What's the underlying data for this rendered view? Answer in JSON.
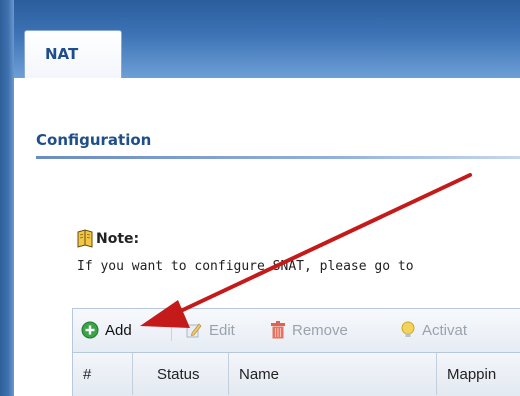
{
  "tabs": [
    {
      "label": "NAT"
    }
  ],
  "section": {
    "title": "Configuration"
  },
  "note": {
    "title": "Note:",
    "text": "If you want to configure SNAT, please go to"
  },
  "toolbar": {
    "add_label": "Add",
    "edit_label": "Edit",
    "remove_label": "Remove",
    "activate_label": "Activat"
  },
  "table": {
    "columns": [
      "#",
      "Status",
      "Name",
      "Mappin"
    ]
  },
  "colors": {
    "header_blue": "#3d74b6",
    "title_blue": "#1f4e8a",
    "annotation_arrow": "#c41a1a"
  }
}
